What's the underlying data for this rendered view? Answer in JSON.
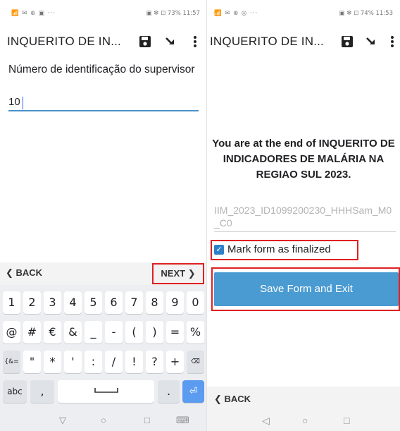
{
  "left": {
    "status": {
      "icons": "📶 ✉ ⊕ ▣ ···",
      "right": "▣ ✻ ⊡ 73% 11:57"
    },
    "toolbar": {
      "title": "INQUERITO DE IN...",
      "save_icon": "save-icon",
      "goto_icon": "jump-arrow-icon",
      "menu_icon": "more-vert-icon"
    },
    "question": {
      "label": "Número de identificação do supervisor",
      "value": "10"
    },
    "nav": {
      "back": "BACK",
      "next": "NEXT"
    },
    "keyboard": {
      "row1": [
        "1",
        "2",
        "3",
        "4",
        "5",
        "6",
        "7",
        "8",
        "9",
        "0"
      ],
      "row2": [
        "@",
        "#",
        "€",
        "&",
        "_",
        "-",
        "(",
        ")",
        "=",
        "%"
      ],
      "row3": [
        "{&=",
        "\"",
        "*",
        "'",
        ":",
        "/",
        "!",
        "?",
        "+",
        "⌫"
      ],
      "row4": {
        "abc": "abc",
        "comma": ",",
        "space": "␣",
        "period": ".",
        "enter": "⏎"
      }
    },
    "system_nav": {
      "back": "▽",
      "home": "○",
      "recents": "□",
      "keyboard": "⌨"
    }
  },
  "right": {
    "status": {
      "icons": "📶 ✉ ⊕ ◎ ···",
      "right": "▣ ✻ ⊡ 74% 11:53"
    },
    "toolbar": {
      "title": "INQUERITO DE IN...",
      "save_icon": "save-icon",
      "goto_icon": "jump-arrow-icon",
      "menu_icon": "more-vert-icon"
    },
    "end_message": "You are at the end of INQUERITO DE INDICADORES DE MALÁRIA NA REGIAO SUL 2023.",
    "instance_name": "IIM_2023_ID1099200230_HHHSam_M0_C0",
    "finalize": {
      "label": "Mark form as finalized",
      "checked": true
    },
    "save_button": "Save Form and Exit",
    "nav": {
      "back": "BACK"
    },
    "system_nav": {
      "back": "◁",
      "home": "○",
      "recents": "□"
    }
  },
  "colors": {
    "accent": "#4a9bd1",
    "highlight": "#e02020",
    "checkbox": "#2f80c9"
  }
}
